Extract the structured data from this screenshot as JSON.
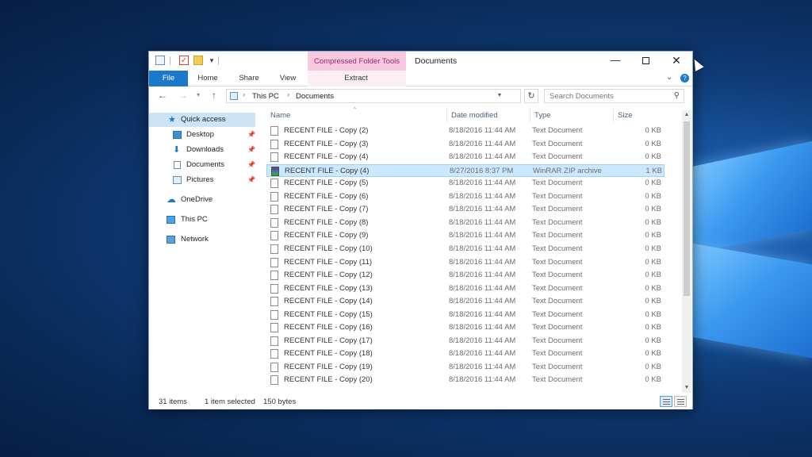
{
  "window": {
    "title": "Documents",
    "contextual_tab_group": "Compressed Folder Tools"
  },
  "ribbon": {
    "tabs": [
      "File",
      "Home",
      "Share",
      "View",
      "Extract"
    ]
  },
  "address": {
    "parts": [
      "This PC",
      "Documents"
    ]
  },
  "search": {
    "placeholder": "Search Documents"
  },
  "navpane": {
    "items": [
      {
        "label": "Quick access",
        "icon": "star-icon",
        "selected": true
      },
      {
        "label": "Desktop",
        "icon": "desktop-icon",
        "pinned": true
      },
      {
        "label": "Downloads",
        "icon": "download-icon",
        "pinned": true
      },
      {
        "label": "Documents",
        "icon": "document-icon",
        "pinned": true
      },
      {
        "label": "Pictures",
        "icon": "pictures-icon",
        "pinned": true
      },
      {
        "label": "OneDrive",
        "icon": "cloud-icon"
      },
      {
        "label": "This PC",
        "icon": "computer-icon"
      },
      {
        "label": "Network",
        "icon": "network-icon"
      }
    ]
  },
  "columns": {
    "name": "Name",
    "date": "Date modified",
    "type": "Type",
    "size": "Size"
  },
  "files": [
    {
      "name": "RECENT FILE - Copy (2)",
      "date": "8/18/2016 11:44 AM",
      "type": "Text Document",
      "size": "0 KB"
    },
    {
      "name": "RECENT FILE - Copy (3)",
      "date": "8/18/2016 11:44 AM",
      "type": "Text Document",
      "size": "0 KB"
    },
    {
      "name": "RECENT FILE - Copy (4)",
      "date": "8/18/2016 11:44 AM",
      "type": "Text Document",
      "size": "0 KB"
    },
    {
      "name": "RECENT FILE - Copy (4)",
      "date": "8/27/2016 8:37 PM",
      "type": "WinRAR ZIP archive",
      "size": "1 KB",
      "selected": true,
      "zip": true
    },
    {
      "name": "RECENT FILE - Copy (5)",
      "date": "8/18/2016 11:44 AM",
      "type": "Text Document",
      "size": "0 KB"
    },
    {
      "name": "RECENT FILE - Copy (6)",
      "date": "8/18/2016 11:44 AM",
      "type": "Text Document",
      "size": "0 KB"
    },
    {
      "name": "RECENT FILE - Copy (7)",
      "date": "8/18/2016 11:44 AM",
      "type": "Text Document",
      "size": "0 KB"
    },
    {
      "name": "RECENT FILE - Copy (8)",
      "date": "8/18/2016 11:44 AM",
      "type": "Text Document",
      "size": "0 KB"
    },
    {
      "name": "RECENT FILE - Copy (9)",
      "date": "8/18/2016 11:44 AM",
      "type": "Text Document",
      "size": "0 KB"
    },
    {
      "name": "RECENT FILE - Copy (10)",
      "date": "8/18/2016 11:44 AM",
      "type": "Text Document",
      "size": "0 KB"
    },
    {
      "name": "RECENT FILE - Copy (11)",
      "date": "8/18/2016 11:44 AM",
      "type": "Text Document",
      "size": "0 KB"
    },
    {
      "name": "RECENT FILE - Copy (12)",
      "date": "8/18/2016 11:44 AM",
      "type": "Text Document",
      "size": "0 KB"
    },
    {
      "name": "RECENT FILE - Copy (13)",
      "date": "8/18/2016 11:44 AM",
      "type": "Text Document",
      "size": "0 KB"
    },
    {
      "name": "RECENT FILE - Copy (14)",
      "date": "8/18/2016 11:44 AM",
      "type": "Text Document",
      "size": "0 KB"
    },
    {
      "name": "RECENT FILE - Copy (15)",
      "date": "8/18/2016 11:44 AM",
      "type": "Text Document",
      "size": "0 KB"
    },
    {
      "name": "RECENT FILE - Copy (16)",
      "date": "8/18/2016 11:44 AM",
      "type": "Text Document",
      "size": "0 KB"
    },
    {
      "name": "RECENT FILE - Copy (17)",
      "date": "8/18/2016 11:44 AM",
      "type": "Text Document",
      "size": "0 KB"
    },
    {
      "name": "RECENT FILE - Copy (18)",
      "date": "8/18/2016 11:44 AM",
      "type": "Text Document",
      "size": "0 KB"
    },
    {
      "name": "RECENT FILE - Copy (19)",
      "date": "8/18/2016 11:44 AM",
      "type": "Text Document",
      "size": "0 KB"
    },
    {
      "name": "RECENT FILE - Copy (20)",
      "date": "8/18/2016 11:44 AM",
      "type": "Text Document",
      "size": "0 KB"
    }
  ],
  "status": {
    "item_count": "31 items",
    "selection": "1 item selected",
    "selection_size": "150 bytes"
  },
  "colors": {
    "file_tab": "#1979ca",
    "contextual_tab": "#f6c9e0",
    "selection": "#cce8ff"
  }
}
